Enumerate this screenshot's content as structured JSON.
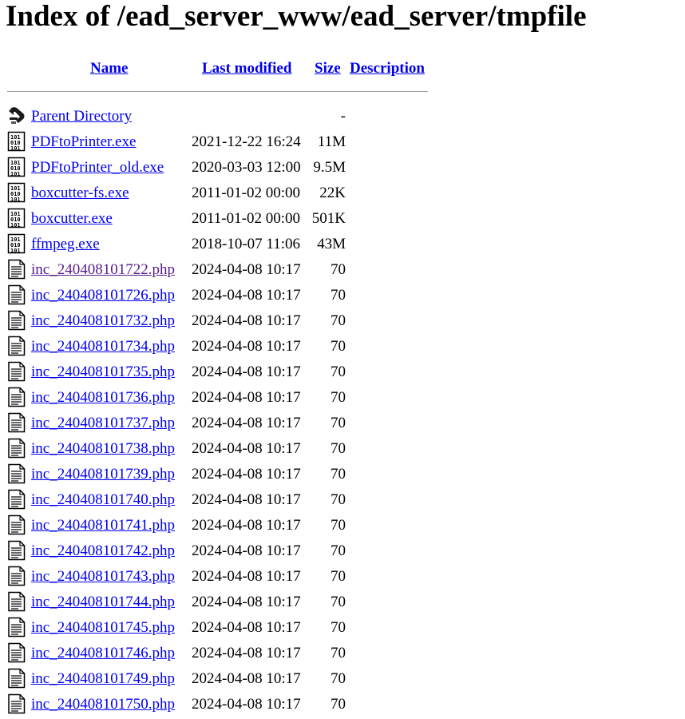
{
  "page": {
    "title": "Index of /ead_server_www/ead_server/tmpfile"
  },
  "table": {
    "headers": {
      "name": "Name",
      "last_modified": "Last modified",
      "size": "Size",
      "description": "Description"
    },
    "parent": {
      "label": "Parent Directory",
      "size": "-",
      "icon": "back-icon"
    },
    "rows": [
      {
        "name": "PDFtoPrinter.exe",
        "date": "2021-12-22 16:24",
        "size": "11M",
        "icon": "binary-file-icon"
      },
      {
        "name": "PDFtoPrinter_old.exe",
        "date": "2020-03-03 12:00",
        "size": "9.5M",
        "icon": "binary-file-icon"
      },
      {
        "name": "boxcutter-fs.exe",
        "date": "2011-01-02 00:00",
        "size": "22K",
        "icon": "binary-file-icon"
      },
      {
        "name": "boxcutter.exe",
        "date": "2011-01-02 00:00",
        "size": "501K",
        "icon": "binary-file-icon"
      },
      {
        "name": "ffmpeg.exe",
        "date": "2018-10-07 11:06",
        "size": "43M",
        "icon": "binary-file-icon"
      },
      {
        "name": "inc_240408101722.php",
        "date": "2024-04-08 10:17",
        "size": "70",
        "icon": "text-file-icon",
        "visited": true
      },
      {
        "name": "inc_240408101726.php",
        "date": "2024-04-08 10:17",
        "size": "70",
        "icon": "text-file-icon"
      },
      {
        "name": "inc_240408101732.php",
        "date": "2024-04-08 10:17",
        "size": "70",
        "icon": "text-file-icon"
      },
      {
        "name": "inc_240408101734.php",
        "date": "2024-04-08 10:17",
        "size": "70",
        "icon": "text-file-icon"
      },
      {
        "name": "inc_240408101735.php",
        "date": "2024-04-08 10:17",
        "size": "70",
        "icon": "text-file-icon"
      },
      {
        "name": "inc_240408101736.php",
        "date": "2024-04-08 10:17",
        "size": "70",
        "icon": "text-file-icon"
      },
      {
        "name": "inc_240408101737.php",
        "date": "2024-04-08 10:17",
        "size": "70",
        "icon": "text-file-icon"
      },
      {
        "name": "inc_240408101738.php",
        "date": "2024-04-08 10:17",
        "size": "70",
        "icon": "text-file-icon"
      },
      {
        "name": "inc_240408101739.php",
        "date": "2024-04-08 10:17",
        "size": "70",
        "icon": "text-file-icon"
      },
      {
        "name": "inc_240408101740.php",
        "date": "2024-04-08 10:17",
        "size": "70",
        "icon": "text-file-icon"
      },
      {
        "name": "inc_240408101741.php",
        "date": "2024-04-08 10:17",
        "size": "70",
        "icon": "text-file-icon"
      },
      {
        "name": "inc_240408101742.php",
        "date": "2024-04-08 10:17",
        "size": "70",
        "icon": "text-file-icon"
      },
      {
        "name": "inc_240408101743.php",
        "date": "2024-04-08 10:17",
        "size": "70",
        "icon": "text-file-icon"
      },
      {
        "name": "inc_240408101744.php",
        "date": "2024-04-08 10:17",
        "size": "70",
        "icon": "text-file-icon"
      },
      {
        "name": "inc_240408101745.php",
        "date": "2024-04-08 10:17",
        "size": "70",
        "icon": "text-file-icon"
      },
      {
        "name": "inc_240408101746.php",
        "date": "2024-04-08 10:17",
        "size": "70",
        "icon": "text-file-icon"
      },
      {
        "name": "inc_240408101749.php",
        "date": "2024-04-08 10:17",
        "size": "70",
        "icon": "text-file-icon"
      },
      {
        "name": "inc_240408101750.php",
        "date": "2024-04-08 10:17",
        "size": "70",
        "icon": "text-file-icon"
      }
    ]
  },
  "colors": {
    "link": "#0000ee",
    "visited_link": "#551a8b",
    "rule": "#a0a0a0"
  }
}
